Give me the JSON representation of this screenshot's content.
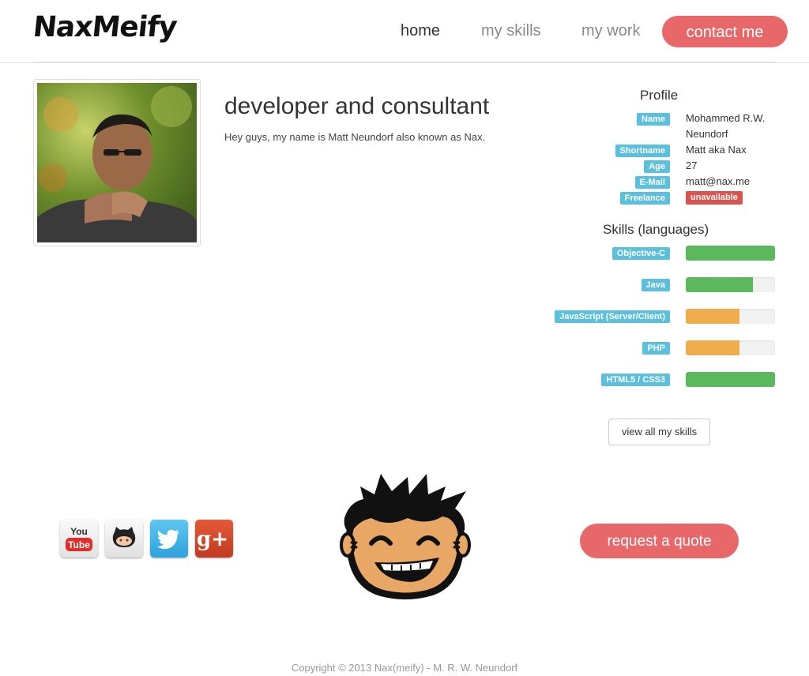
{
  "brand": {
    "logo_text": "NaxMeify"
  },
  "nav": {
    "home": "home",
    "skills": "my skills",
    "work": "my work",
    "contact": "contact me"
  },
  "hero": {
    "headline": "developer and consultant",
    "intro": "Hey guys, my name is Matt Neundorf also known as Nax."
  },
  "profile": {
    "title": "Profile",
    "name_label": "Name",
    "name_line1": "Mohammed R.W.",
    "name_line2": "Neundorf",
    "shortname_label": "Shortname",
    "shortname": "Matt aka Nax",
    "age_label": "Age",
    "age": "27",
    "email_label": "E-Mail",
    "email": "matt@nax.me",
    "freelance_label": "Freelance",
    "freelance": "unavailable"
  },
  "skills": {
    "title": "Skills (languages)",
    "items": [
      {
        "label": "Objective-C",
        "level": 1.0,
        "color": "#5cb85c"
      },
      {
        "label": "Java",
        "level": 0.75,
        "color": "#5cb85c"
      },
      {
        "label": "JavaScript (Server/Client)",
        "level": 0.6,
        "color": "#f0ad4e"
      },
      {
        "label": "PHP",
        "level": 0.6,
        "color": "#f0ad4e"
      },
      {
        "label": "HTML5 / CSS3",
        "level": 1.0,
        "color": "#5cb85c"
      }
    ],
    "view_all": "view all my skills"
  },
  "social": {
    "youtube_you": "You",
    "youtube_tube": "Tube",
    "gplus": "g+"
  },
  "cta": {
    "quote": "request a quote"
  },
  "footer": {
    "copyright": "Copyright © 2013 Nax(meify) - M. R. W. Neundorf"
  },
  "colors": {
    "accent": "#e8686a",
    "label_blue": "#5bc0de",
    "danger": "#d9534f",
    "success": "#5cb85c",
    "warning": "#f0ad4e"
  }
}
